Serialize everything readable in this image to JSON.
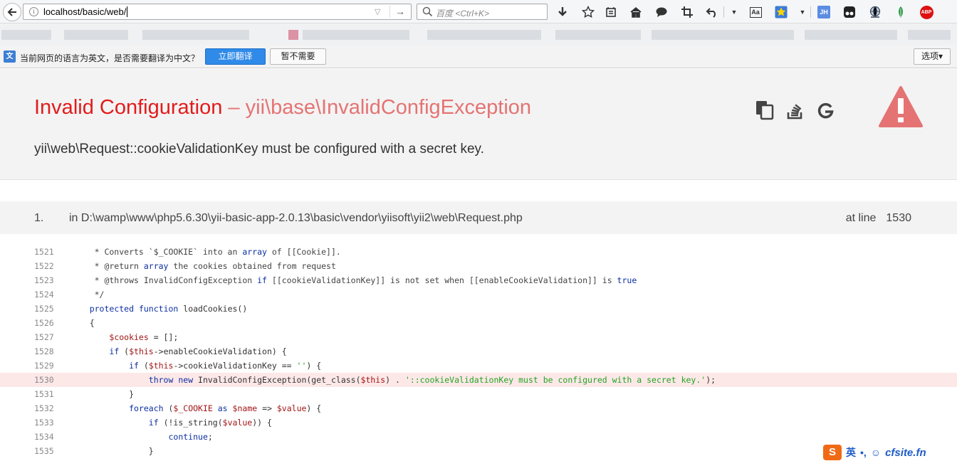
{
  "browser": {
    "url": "localhost/basic/web/",
    "search_placeholder": "百度 <Ctrl+K>",
    "toolbar_icons": [
      "download-icon",
      "bookmark-star-icon",
      "reader-icon",
      "home-icon",
      "chat-icon",
      "crop-icon",
      "undo-icon",
      "translate-icon",
      "star-extension-icon",
      "jh-extension-icon",
      "tampermonkey-icon",
      "globe-icon",
      "leaf-icon",
      "adblock-icon"
    ],
    "ext_jh_label": "JH",
    "ext_abp_label": "ABP",
    "ext_translate_label": "Aa"
  },
  "translate_bar": {
    "message": "当前网页的语言为英文，是否需要翻译为中文？",
    "translate_label": "立即翻译",
    "decline_label": "暂不需要",
    "options_label": "选项▾"
  },
  "error": {
    "title_prefix": "Invalid Configuration",
    "title_dash": " – ",
    "title_class": "yii\\base\\InvalidConfigException",
    "message": "yii\\web\\Request::cookieValidationKey must be configured with a secret key.",
    "accent_color": "#e21b1b",
    "warning_color": "#e57373"
  },
  "stack": {
    "index": "1.",
    "file": "in D:\\wamp\\www\\php5.6.30\\yii-basic-app-2.0.13\\basic\\vendor\\yiisoft\\yii2\\web\\Request.php",
    "at_line_label": "at line",
    "line": "1530"
  },
  "code_lines": [
    {
      "n": "1521",
      "text": "     * Converts `$_COOKIE` into an array of [[Cookie]]."
    },
    {
      "n": "1522",
      "text": "     * @return array the cookies obtained from request"
    },
    {
      "n": "1523",
      "text": "     * @throws InvalidConfigException if [[cookieValidationKey]] is not set when [[enableCookieValidation]] is true"
    },
    {
      "n": "1524",
      "text": "     */"
    },
    {
      "n": "1525",
      "text": "    protected function loadCookies()"
    },
    {
      "n": "1526",
      "text": "    {"
    },
    {
      "n": "1527",
      "text": "        $cookies = [];"
    },
    {
      "n": "1528",
      "text": "        if ($this->enableCookieValidation) {"
    },
    {
      "n": "1529",
      "text": "            if ($this->cookieValidationKey == '') {"
    },
    {
      "n": "1530",
      "text": "                throw new InvalidConfigException(get_class($this) . '::cookieValidationKey must be configured with a secret key.');"
    },
    {
      "n": "1531",
      "text": "            }"
    },
    {
      "n": "1532",
      "text": "            foreach ($_COOKIE as $name => $value) {"
    },
    {
      "n": "1533",
      "text": "                if (!is_string($value)) {"
    },
    {
      "n": "1534",
      "text": "                    continue;"
    },
    {
      "n": "1535",
      "text": "                }"
    }
  ],
  "highlighted_line": "1530",
  "ime": {
    "logo": "S",
    "lang": "英",
    "punct": "•,",
    "watermark": "cfsite.fn"
  }
}
